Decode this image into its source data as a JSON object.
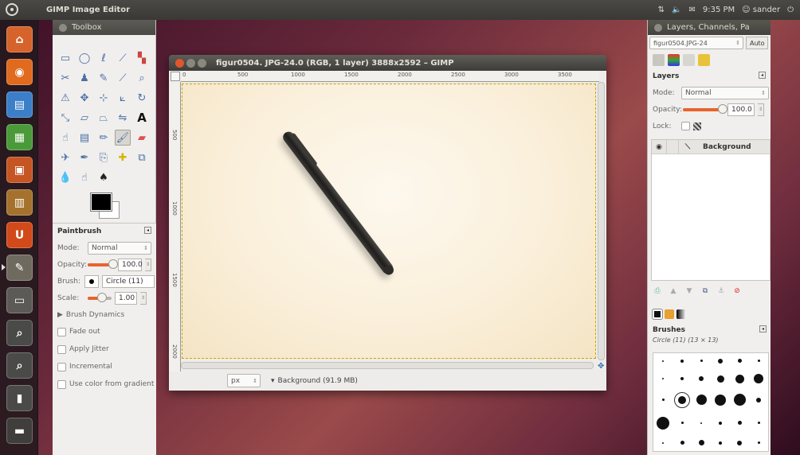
{
  "top_panel": {
    "app_title": "GIMP Image Editor",
    "clock": "9:35 PM",
    "user": "sander"
  },
  "launcher": {
    "items": [
      {
        "name": "home-folder-icon",
        "color": "#d6632b"
      },
      {
        "name": "firefox-icon",
        "color": "#e06a1e"
      },
      {
        "name": "writer-icon",
        "color": "#3a7fc7"
      },
      {
        "name": "calc-icon",
        "color": "#4a9a3a"
      },
      {
        "name": "impress-icon",
        "color": "#c55522"
      },
      {
        "name": "software-center-icon",
        "color": "#a5722d"
      },
      {
        "name": "ubuntu-one-icon",
        "color": "#d24a1a"
      },
      {
        "name": "gimp-icon",
        "color": "#6e6a5e"
      },
      {
        "name": "workspace-switcher-icon",
        "color": "#5b5a57"
      },
      {
        "name": "dash-search-icon",
        "color": "#4a4a48"
      },
      {
        "name": "dash-apps-icon",
        "color": "#4a4a48"
      },
      {
        "name": "usb-drive-icon",
        "color": "#4a4a48"
      },
      {
        "name": "trash-icon",
        "color": "#3f3e3c"
      }
    ]
  },
  "toolbox": {
    "title": "Toolbox",
    "tool_options": {
      "heading": "Paintbrush",
      "mode_label": "Mode:",
      "mode_value": "Normal",
      "opacity_label": "Opacity:",
      "opacity_value": "100.0",
      "brush_label": "Brush:",
      "brush_value": "Circle (11)",
      "scale_label": "Scale:",
      "scale_value": "1.00",
      "brush_dynamics": "Brush Dynamics",
      "checkboxes": [
        "Fade out",
        "Apply Jitter",
        "Incremental",
        "Use color from gradient"
      ]
    }
  },
  "image_window": {
    "title": "figur0504. JPG-24.0 (RGB, 1 layer) 3888x2592 – GIMP",
    "ruler_h_labels": [
      "0",
      "500",
      "1000",
      "1500",
      "2000",
      "2500",
      "3000",
      "3500"
    ],
    "ruler_v_labels": [
      "500",
      "1000",
      "1500",
      "2000"
    ],
    "unit": "px",
    "status_text": "Background (91.9 MB)"
  },
  "dock": {
    "title": "Layers, Channels, Pa",
    "image_select": "figur0504.JPG-24",
    "auto_button": "Auto",
    "layers_heading": "Layers",
    "mode_label": "Mode:",
    "mode_value": "Normal",
    "opacity_label": "Opacity:",
    "opacity_value": "100.0",
    "lock_label": "Lock:",
    "layer_name": "Background",
    "brushes_heading": "Brushes",
    "brush_info": "Circle (11) (13 × 13)"
  },
  "colors": {
    "accent": "#e8632d",
    "canvas": "#faf1e0"
  }
}
